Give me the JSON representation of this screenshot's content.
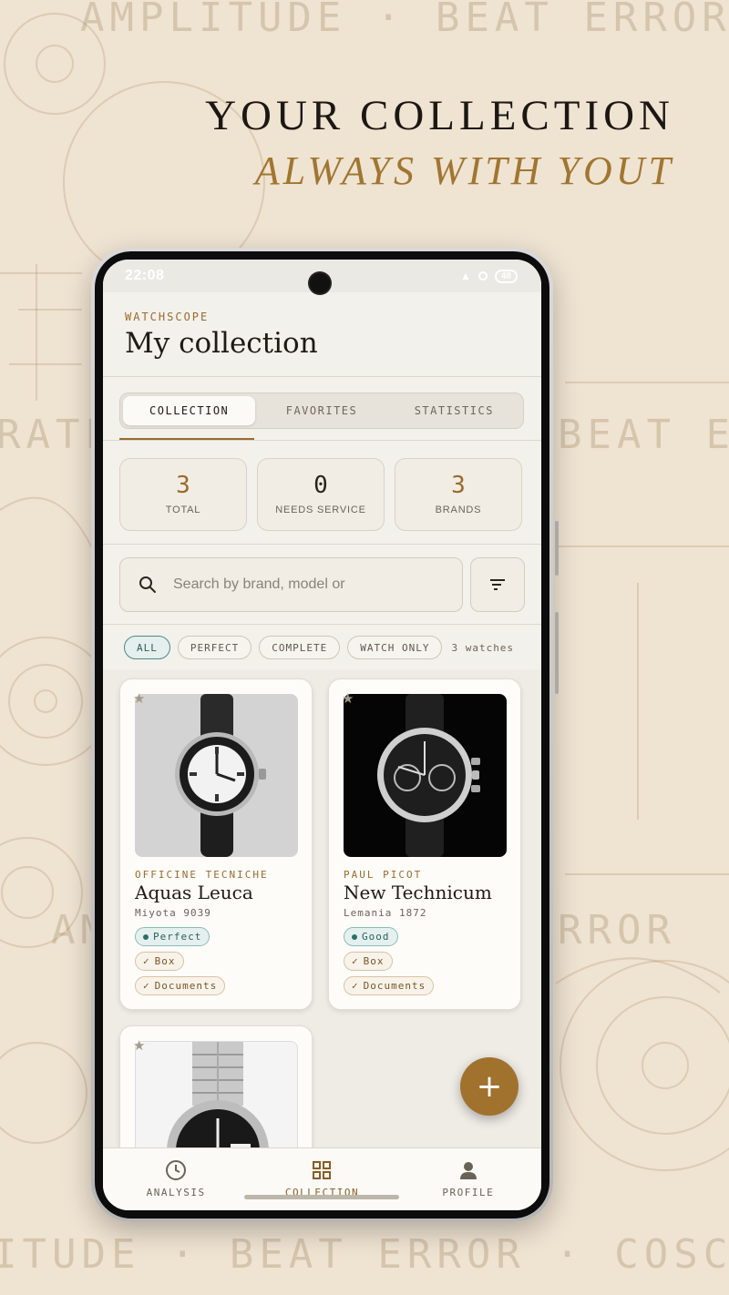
{
  "marketing": {
    "headline": "YOUR COLLECTION",
    "subheadline": "ALWAYS WITH YOUT",
    "bg_words": {
      "top": "AMPLITUDE · BEAT ERROR",
      "mid_left": "RATE",
      "mid_right": "BEAT ER",
      "lower_left": "AM",
      "lower_right": "RROR",
      "bottom": "ITUDE · BEAT ERROR · COSC"
    }
  },
  "status_bar": {
    "time": "22:08",
    "battery": "48"
  },
  "header": {
    "overline": "WATCHSCOPE",
    "title": "My collection"
  },
  "tabs": [
    {
      "label": "COLLECTION",
      "active": true
    },
    {
      "label": "FAVORITES",
      "active": false
    },
    {
      "label": "STATISTICS",
      "active": false
    }
  ],
  "stats": [
    {
      "value": "3",
      "label": "TOTAL"
    },
    {
      "value": "0",
      "label": "NEEDS SERVICE"
    },
    {
      "value": "3",
      "label": "BRANDS"
    }
  ],
  "search": {
    "placeholder": "Search by brand, model or"
  },
  "filters": {
    "chips": [
      "ALL",
      "PERFECT",
      "COMPLETE",
      "WATCH ONLY"
    ],
    "active": "ALL",
    "count_label": "3 watches"
  },
  "watches": [
    {
      "brand": "OFFICINE TECNICHE",
      "model": "Aquas Leuca",
      "movement": "Miyota 9039",
      "condition": "Perfect",
      "accessories": [
        "Box",
        "Documents"
      ]
    },
    {
      "brand": "PAUL PICOT",
      "model": "New Technicum",
      "movement": "Lemania 1872",
      "condition": "Good",
      "accessories": [
        "Box",
        "Documents"
      ]
    }
  ],
  "fab": {
    "label": "+"
  },
  "bottom_nav": [
    {
      "label": "ANALYSIS",
      "icon": "clock-icon"
    },
    {
      "label": "COLLECTION",
      "icon": "grid-icon"
    },
    {
      "label": "PROFILE",
      "icon": "person-icon"
    }
  ],
  "colors": {
    "accent": "#9a6b2c",
    "fab": "#a0722e",
    "condition_teal": "#2c5f5b",
    "background_paper": "#efe3d2",
    "screen_bg": "#f3f1ec"
  }
}
